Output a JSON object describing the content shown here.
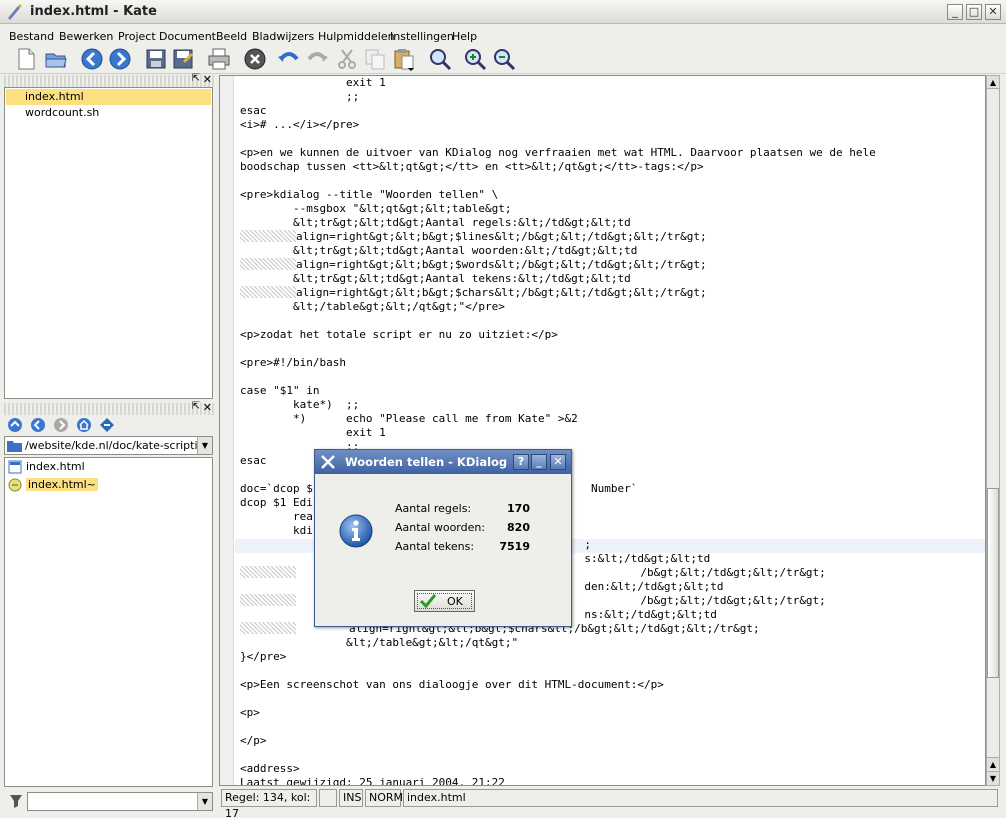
{
  "window": {
    "title": "index.html - Kate"
  },
  "menu": [
    "Bestand",
    "Bewerken",
    "Project",
    "Document",
    "Beeld",
    "Bladwijzers",
    "Hulpmiddelen",
    "Instellingen",
    "Help"
  ],
  "toolbar": {
    "icons": [
      "new-document-icon",
      "open-icon",
      "back-icon",
      "forward-icon",
      "save-icon",
      "save-as-icon",
      "print-icon",
      "close-icon",
      "undo-icon",
      "redo-icon",
      "cut-icon",
      "copy-icon",
      "paste-icon",
      "find-icon",
      "zoom-in-icon",
      "zoom-out-icon"
    ]
  },
  "docs": {
    "items": [
      "index.html",
      "wordcount.sh"
    ],
    "selected": 0
  },
  "filebrowser": {
    "path": "/website/kde.nl/doc/kate-scripting/",
    "items": [
      "index.html",
      "index.html~"
    ],
    "selected": 1
  },
  "filter": {
    "value": ""
  },
  "code": [
    {
      "ind": 0,
      "t": "                exit 1"
    },
    {
      "ind": 0,
      "t": "                ;;"
    },
    {
      "ind": 0,
      "t": "esac"
    },
    {
      "ind": 0,
      "t": "<i># ...</i></pre>"
    },
    {
      "ind": 0,
      "t": ""
    },
    {
      "ind": 0,
      "t": "<p>en we kunnen de uitvoer van KDialog nog verfraaien met wat HTML. Daarvoor plaatsen we de hele"
    },
    {
      "ind": 0,
      "t": "boodschap tussen <tt>&lt;qt&gt;</tt> en <tt>&lt;/qt&gt;</tt>-tags:</p>"
    },
    {
      "ind": 0,
      "t": ""
    },
    {
      "ind": 0,
      "t": "<pre>kdialog --title \"Woorden tellen\" \\"
    },
    {
      "ind": 0,
      "t": "        --msgbox \"&lt;qt&gt;&lt;table&gt;"
    },
    {
      "ind": 0,
      "t": "        &lt;tr&gt;&lt;td&gt;Aantal regels:&lt;/td&gt;&lt;td"
    },
    {
      "ind": 1,
      "t": "align=right&gt;&lt;b&gt;$lines&lt;/b&gt;&lt;/td&gt;&lt;/tr&gt;"
    },
    {
      "ind": 0,
      "t": "        &lt;tr&gt;&lt;td&gt;Aantal woorden:&lt;/td&gt;&lt;td"
    },
    {
      "ind": 1,
      "t": "align=right&gt;&lt;b&gt;$words&lt;/b&gt;&lt;/td&gt;&lt;/tr&gt;"
    },
    {
      "ind": 0,
      "t": "        &lt;tr&gt;&lt;td&gt;Aantal tekens:&lt;/td&gt;&lt;td"
    },
    {
      "ind": 1,
      "t": "align=right&gt;&lt;b&gt;$chars&lt;/b&gt;&lt;/td&gt;&lt;/tr&gt;"
    },
    {
      "ind": 0,
      "t": "        &lt;/table&gt;&lt;/qt&gt;\"</pre>"
    },
    {
      "ind": 0,
      "t": ""
    },
    {
      "ind": 0,
      "t": "<p>zodat het totale script er nu zo uitziet:</p>"
    },
    {
      "ind": 0,
      "t": ""
    },
    {
      "ind": 0,
      "t": "<pre>#!/bin/bash"
    },
    {
      "ind": 0,
      "t": ""
    },
    {
      "ind": 0,
      "t": "case \"$1\" in"
    },
    {
      "ind": 0,
      "t": "        kate*)  ;;"
    },
    {
      "ind": 0,
      "t": "        *)      echo \"Please call me from Kate\" >&2"
    },
    {
      "ind": 0,
      "t": "                exit 1"
    },
    {
      "ind": 0,
      "t": "                ;;"
    },
    {
      "ind": 0,
      "t": "esac"
    },
    {
      "ind": 0,
      "t": ""
    },
    {
      "ind": 0,
      "t": "doc=`dcop $                                          Number`"
    },
    {
      "ind": 0,
      "t": "dcop $1 Edi"
    },
    {
      "ind": 0,
      "t": "        rea"
    },
    {
      "ind": 0,
      "t": "        kdi"
    },
    {
      "ind": 0,
      "t": "                                                    ;"
    },
    {
      "ind": 0,
      "t": "                                                    s:&lt;/td&gt;&lt;td"
    },
    {
      "ind": 1,
      "t": "                                                    /b&gt;&lt;/td&gt;&lt;/tr&gt;"
    },
    {
      "ind": 0,
      "t": "                                                    den:&lt;/td&gt;&lt;td"
    },
    {
      "ind": 1,
      "t": "                                                    /b&gt;&lt;/td&gt;&lt;/tr&gt;"
    },
    {
      "ind": 0,
      "t": "                                                    ns:&lt;/td&gt;&lt;td"
    },
    {
      "ind": 1,
      "t": "        align=right&gt;&lt;b&gt;$chars&lt;/b&gt;&lt;/td&gt;&lt;/tr&gt;"
    },
    {
      "ind": 0,
      "t": "                &lt;/table&gt;&lt;/qt&gt;\""
    },
    {
      "ind": 0,
      "t": "}</pre>"
    },
    {
      "ind": 0,
      "t": ""
    },
    {
      "ind": 0,
      "t": "<p>Een screenschot van ons dialoogje over dit HTML-document:</p>"
    },
    {
      "ind": 0,
      "t": ""
    },
    {
      "ind": 0,
      "t": "<p>"
    },
    {
      "ind": 0,
      "t": ""
    },
    {
      "ind": 0,
      "t": "</p>"
    },
    {
      "ind": 0,
      "t": ""
    },
    {
      "ind": 0,
      "t": "<address>"
    },
    {
      "ind": 0,
      "t": "Laatst gewijzigd: 25 januari 2004, 21:22"
    }
  ],
  "status": {
    "position": "Regel: 134, kol: 17",
    "mod": "",
    "ins": "INS",
    "mode": "NORM",
    "file": "index.html"
  },
  "dialog": {
    "title": "Woorden tellen - KDialog",
    "rows": [
      {
        "label": "Aantal regels:",
        "value": "170"
      },
      {
        "label": "Aantal woorden:",
        "value": "820"
      },
      {
        "label": "Aantal tekens:",
        "value": "7519"
      }
    ],
    "ok_label": "OK"
  }
}
